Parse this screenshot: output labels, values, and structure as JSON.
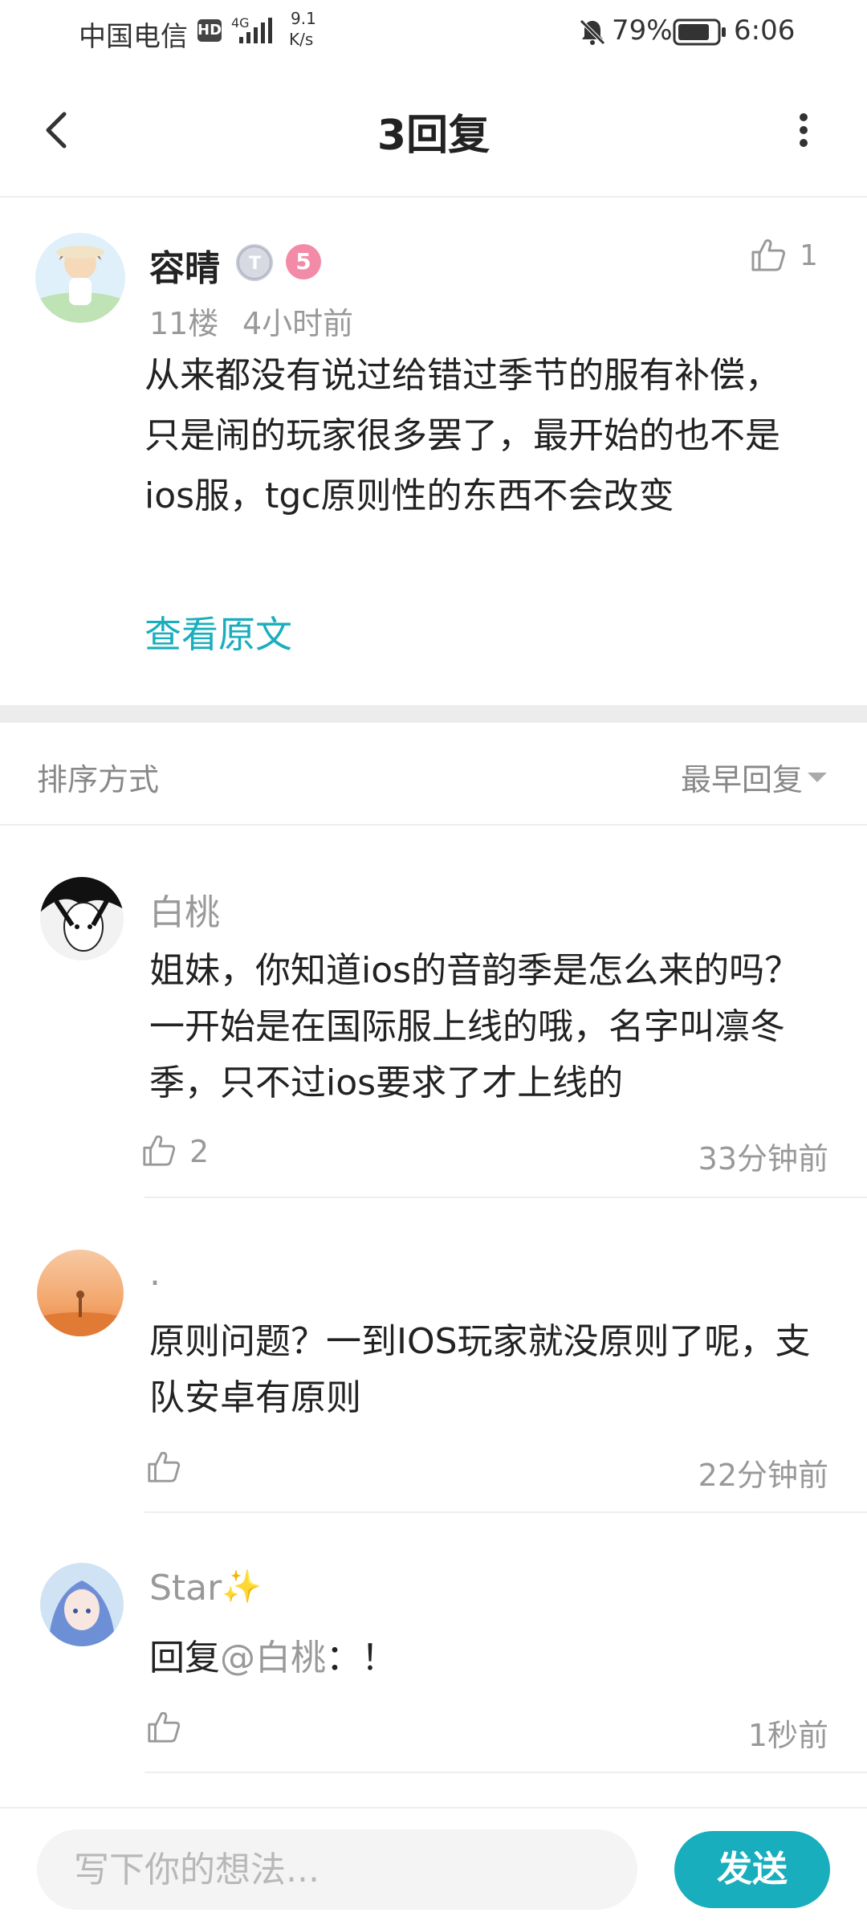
{
  "status_bar": {
    "carrier": "中国电信",
    "hd": "HD",
    "network": "4G",
    "speed_value": "9.1",
    "speed_unit": "K/s",
    "battery": "79%",
    "time": "6:06"
  },
  "header": {
    "title": "3回复"
  },
  "main_post": {
    "author": "容晴",
    "level_badge": "5",
    "floor": "11楼",
    "time": "4小时前",
    "like_count": "1",
    "content": "从来都没有说过给错过季节的服有补偿，只是闹的玩家很多罢了，最开始的也不是ios服，tgc原则性的东西不会改变",
    "view_original": "查看原文"
  },
  "sort": {
    "label": "排序方式",
    "value": "最早回复"
  },
  "replies": [
    {
      "author": "白桃",
      "content": "姐妹，你知道ios的音韵季是怎么来的吗？一开始是在国际服上线的哦，名字叫凛冬季，只不过ios要求了才上线的",
      "like_count": "2",
      "time": "33分钟前"
    },
    {
      "author": ".",
      "content": "原则问题？一到IOS玩家就没原则了呢，支队安卓有原则",
      "like_count": "",
      "time": "22分钟前"
    },
    {
      "author": "Star",
      "author_emoji": "✨",
      "content_prefix": "回复",
      "mention": "@白桃",
      "content_suffix": "：！",
      "like_count": "",
      "time": "1秒前"
    }
  ],
  "input": {
    "placeholder": "写下你的想法..."
  },
  "send_button": {
    "label": "发送"
  },
  "colors": {
    "accent": "#19aebd",
    "muted_text": "#999999",
    "divider": "#eeeeee"
  }
}
